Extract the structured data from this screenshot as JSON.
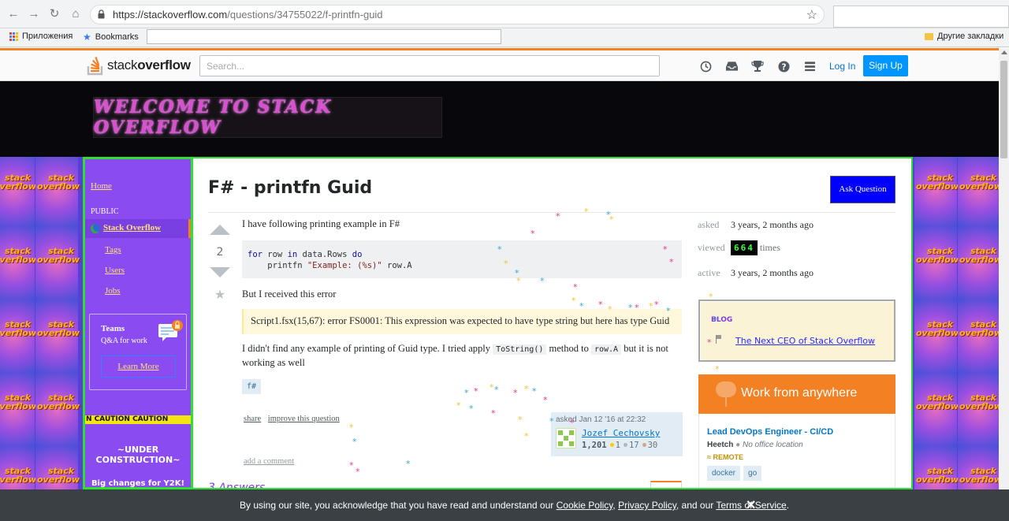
{
  "browser": {
    "url_host": "https://stackoverflow.com",
    "url_path": "/questions/34755022/f-printfn-guid",
    "bookmarks": [
      {
        "label": "Приложения",
        "icon": "apps-icon"
      },
      {
        "label": "Bookmarks",
        "icon": "star-icon"
      }
    ],
    "other_bookmarks": "Другие закладки"
  },
  "topbar": {
    "logo_plain": "stack",
    "logo_bold": "overflow",
    "search_placeholder": "Search...",
    "icons": [
      "history-icon",
      "inbox-icon",
      "achievements-icon",
      "help-icon",
      "site-switcher-icon"
    ],
    "login": "Log In",
    "signup": "Sign Up"
  },
  "banner": {
    "welcome": "WELCOME TO STACK OVERFLOW"
  },
  "tiles": {
    "line1": "stack",
    "line2": "overflow"
  },
  "sidebar": {
    "home": "Home",
    "public": "PUBLIC",
    "stackoverflow": "Stack Overflow",
    "tags": "Tags",
    "users": "Users",
    "jobs": "Jobs",
    "teams_title": "Teams",
    "teams_sub": "Q&A for work",
    "learn_more": "Learn More",
    "caution": "N  CAUTION   CAUTION",
    "construction": "~UNDER CONSTRUCTION~",
    "y2k": "Big changes for Y2K!"
  },
  "question": {
    "title": "F# - printfn Guid",
    "ask_button": "Ask Question",
    "votes": "2",
    "p1": "I have following printing example in F#",
    "code_line1_kw1": "for",
    "code_line1_mid": " row ",
    "code_line1_kw2": "in",
    "code_line1_rest": " data.Rows ",
    "code_line1_kw3": "do",
    "code_line2_pre": "    printfn ",
    "code_line2_str": "\"Example: (%s)\"",
    "code_line2_post": " row.A",
    "p2": "But I received this error",
    "error": "Script1.fsx(15,67): error FS0001: This expression was expected to have type string but here has type Guid",
    "p3_a": "I didn't find any example of printing of Guid type. I tried apply ",
    "p3_code1": "ToString()",
    "p3_b": " method to ",
    "p3_code2": "row.A",
    "p3_c": " but it is not working as well",
    "tag": "f#",
    "share": "share",
    "improve": "improve this question",
    "asked_label": "asked Jan 12 '16 at 22:32",
    "user_name": "Jozef Cechovsky",
    "user_rep": "1,201",
    "badge_gold": "1",
    "badge_silver": "17",
    "badge_bronze": "30",
    "add_comment": "add a comment",
    "answers_header": "3 Answers"
  },
  "stats": {
    "asked_label": "asked",
    "asked_value": "3 years, 2 months ago",
    "viewed_label": "viewed",
    "viewed_digits": "664",
    "viewed_suffix": "times",
    "active_label": "active",
    "active_value": "3 years, 2 months ago"
  },
  "blog": {
    "header": "BLOG",
    "link": "The Next CEO of Stack Overflow"
  },
  "jobs": {
    "banner": "Work from anywhere",
    "title": "Lead DevOps Engineer - CI/CD",
    "company": "Heetch",
    "location": "No office location",
    "remote": "REMOTE",
    "tags": [
      "docker",
      "go"
    ]
  },
  "cookie": {
    "text_a": "By using our site, you acknowledge that you have read and understand our ",
    "cookie_policy": "Cookie Policy",
    "sep1": ", ",
    "privacy_policy": "Privacy Policy",
    "text_b": ", and our ",
    "terms": "Terms of Service",
    "text_c": "."
  },
  "colors": {
    "accent": "#f48024",
    "link": "#0077cc",
    "sidebar_bg": "#8a4cf0",
    "frame_green": "#30e030",
    "sparkle_colors": [
      "#e8388f",
      "#f2c230",
      "#3aa6d0"
    ]
  }
}
